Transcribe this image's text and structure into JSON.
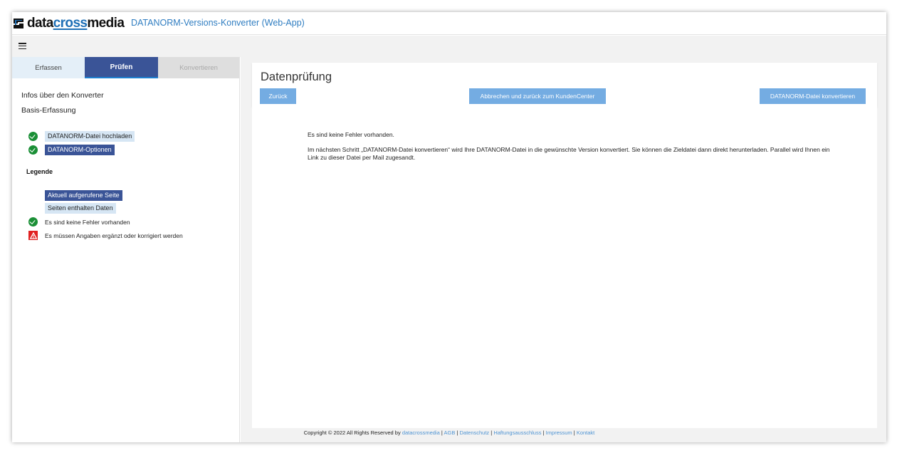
{
  "header": {
    "logo_prefix": "data",
    "logo_middle": "cross",
    "logo_suffix": "media",
    "app_title": "DATANORM-Versions-Konverter (Web-App)"
  },
  "menubar": {
    "menu_icon": "hamburger-menu-icon"
  },
  "tabs": [
    {
      "label": "Erfassen",
      "state": "done"
    },
    {
      "label": "Prüfen",
      "state": "active"
    },
    {
      "label": "Konvertieren",
      "state": "disabled"
    }
  ],
  "sidebar": {
    "info_link": "Infos über den Konverter",
    "section_title": "Basis-Erfassung",
    "items": [
      {
        "label": "DATANORM-Datei hochladen",
        "status_icon": "check-icon"
      },
      {
        "label": "DATANORM-Optionen",
        "status_icon": "check-icon"
      }
    ],
    "legend": {
      "title": "Legende",
      "current_page": "Aktuell aufgerufene Seite",
      "pages_with_data": "Seiten enthalten Daten",
      "no_errors": "Es sind keine Fehler vorhanden",
      "needs_input": "Es müssen Angaben ergänzt oder korrigiert werden"
    }
  },
  "main": {
    "title": "Datenprüfung",
    "buttons": {
      "back": "Zurück",
      "cancel": "Abbrechen und zurück zum KundenCenter",
      "convert": "DATANORM-Datei konvertieren"
    },
    "message_1": "Es sind keine Fehler vorhanden.",
    "message_2": "Im nächsten Schritt „DATANORM-Datei konvertieren“ wird Ihre DATANORM-Datei in die gewünschte Version konvertiert. Sie können die Zieldatei dann direkt herunterladen. Parallel wird Ihnen ein Link zu dieser Datei per Mail zugesandt."
  },
  "footer": {
    "copyright": "Copyright © 2022 All Rights Reserved by",
    "brand_link": "datacrossmedia",
    "separator": "|",
    "links": [
      "AGB",
      "Datenschutz",
      "Haftungsausschluss",
      "Impressum",
      "Kontakt"
    ]
  },
  "colors": {
    "active_tab": "#3a5497",
    "button": "#74ace2",
    "link": "#2f7dc1",
    "success": "#1a8f36",
    "error": "#e12222"
  }
}
